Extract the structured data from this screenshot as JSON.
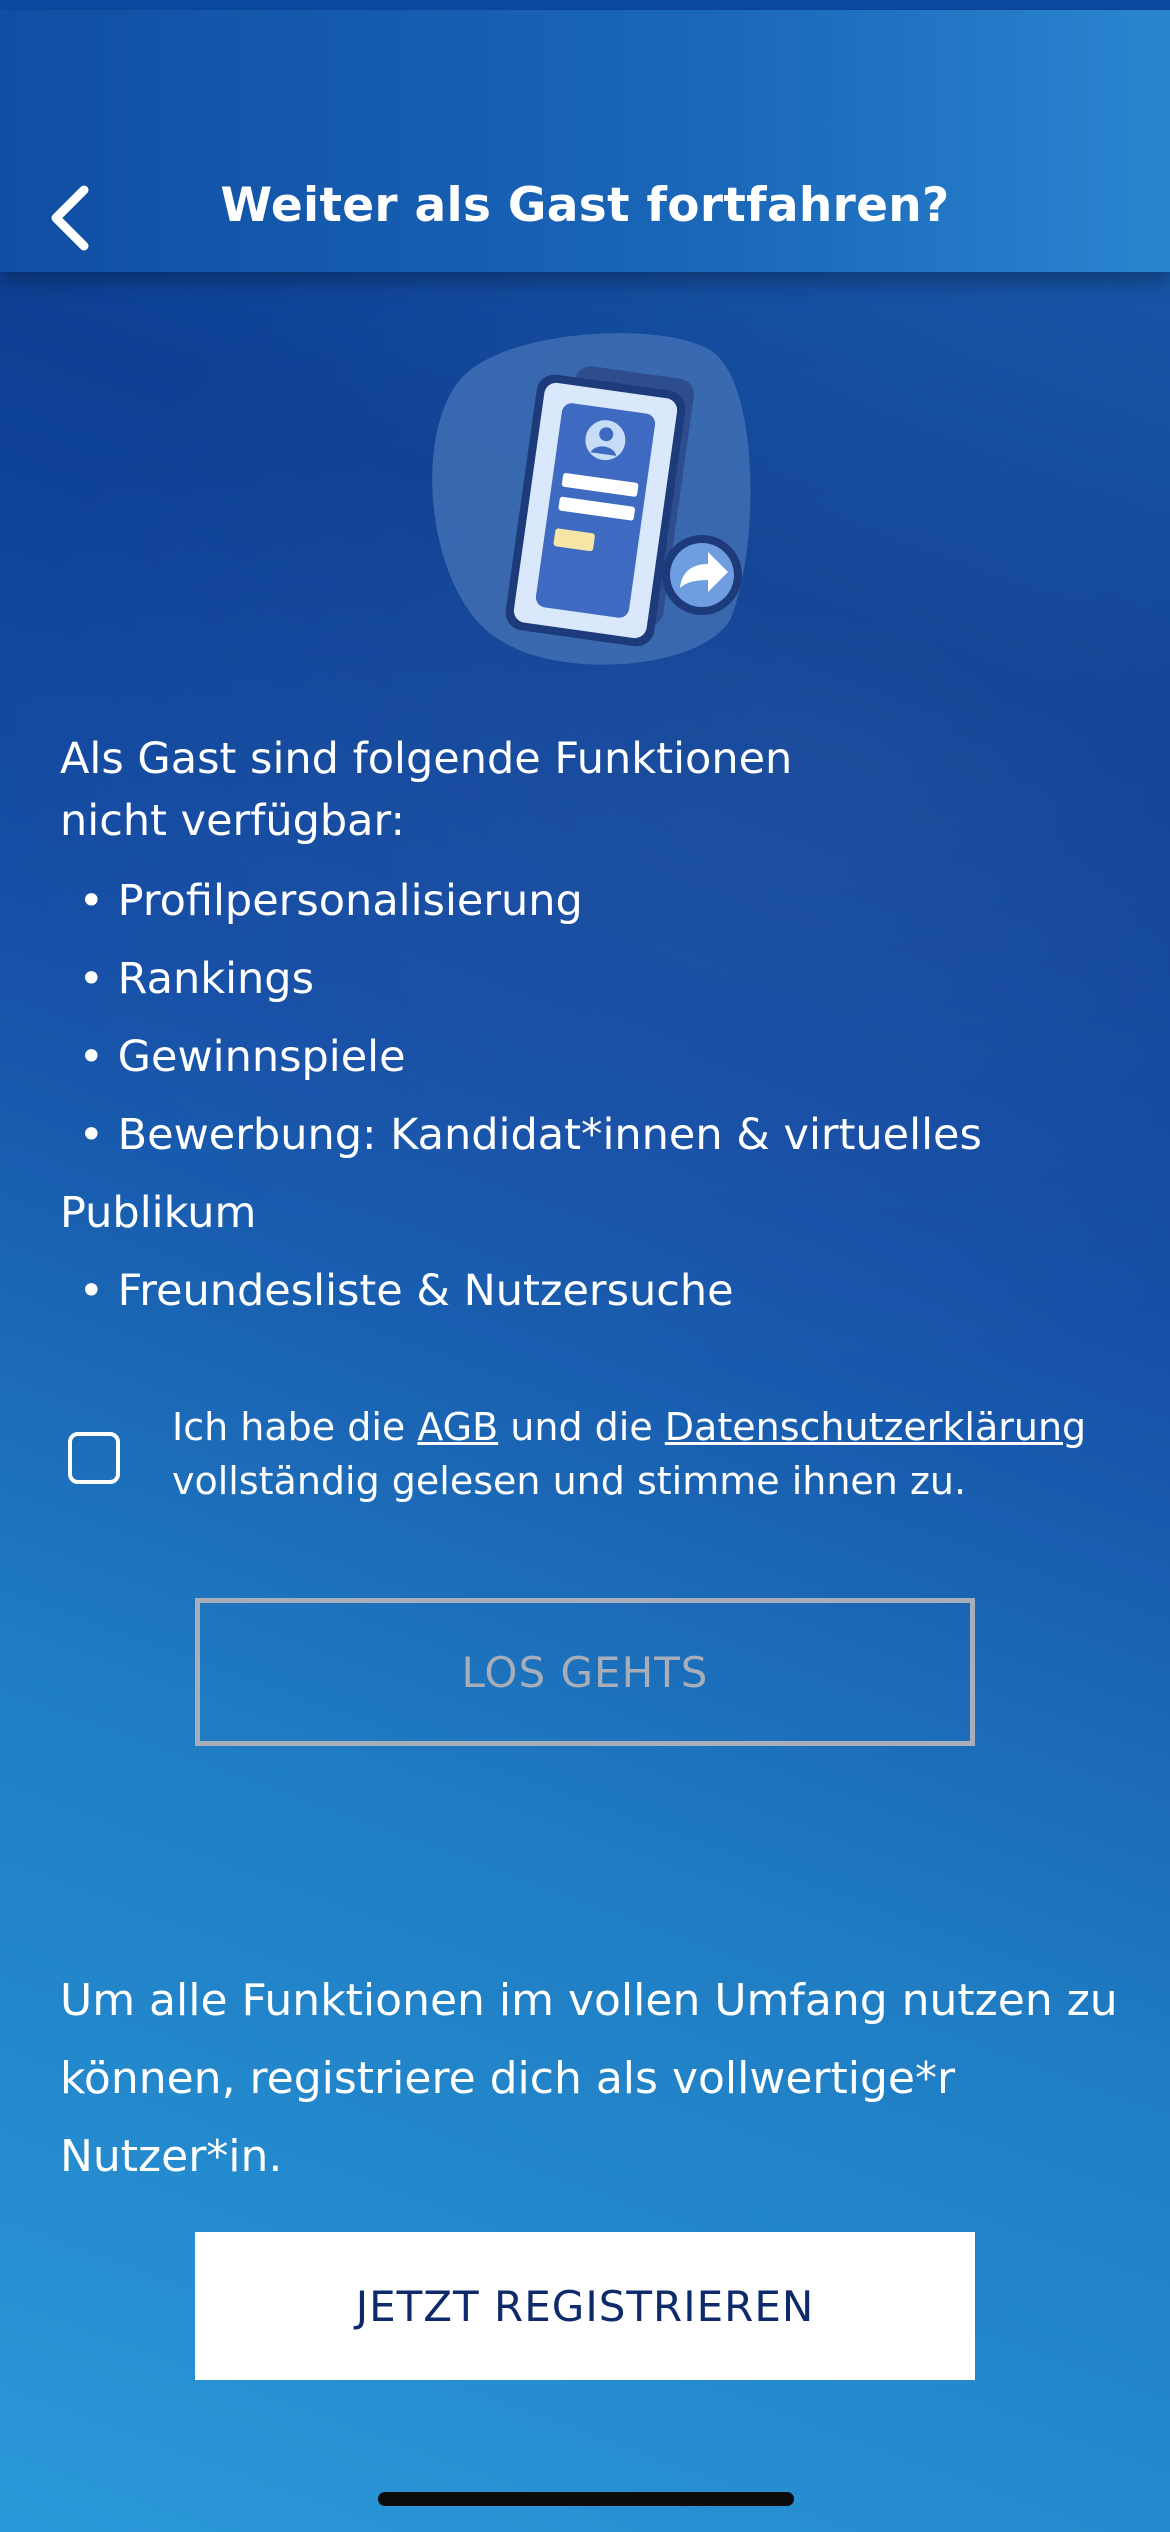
{
  "header": {
    "title": "Weiter als Gast fortfahren?",
    "back_icon": "chevron-left-icon"
  },
  "illustration": {
    "icon": "phone-login-forward-illustration"
  },
  "intro": {
    "line1": "Als Gast sind folgende Funktionen",
    "line2": "nicht verfügbar:"
  },
  "features": {
    "bullet": "•",
    "items": [
      "Profilpersonalisierung",
      "Rankings",
      "Gewinnspiele",
      "Bewerbung: Kandidat*innen & virtuelles",
      "Freundesliste & Nutzersuche"
    ],
    "wrap_continuation": "Publikum"
  },
  "consent": {
    "checked": false,
    "text_before": "Ich habe die ",
    "agb_link": "AGB",
    "text_middle": " und die ",
    "privacy_link": "Datenschutzerklärung",
    "text_after": "vollständig gelesen und stimme ihnen zu."
  },
  "buttons": {
    "los": "LOS GEHTS",
    "register": "JETZT REGISTRIEREN"
  },
  "register_info": {
    "line1": "Um alle Funktionen im vollen Umfang nutzen zu",
    "line2": "können, registriere dich als vollwertige*r",
    "line3": "Nutzer*in."
  },
  "colors": {
    "background_top": "#0d3f93",
    "background_bottom": "#2a98d8",
    "disabled_button": "#a7aeb9",
    "register_text": "#0d2a6b"
  }
}
